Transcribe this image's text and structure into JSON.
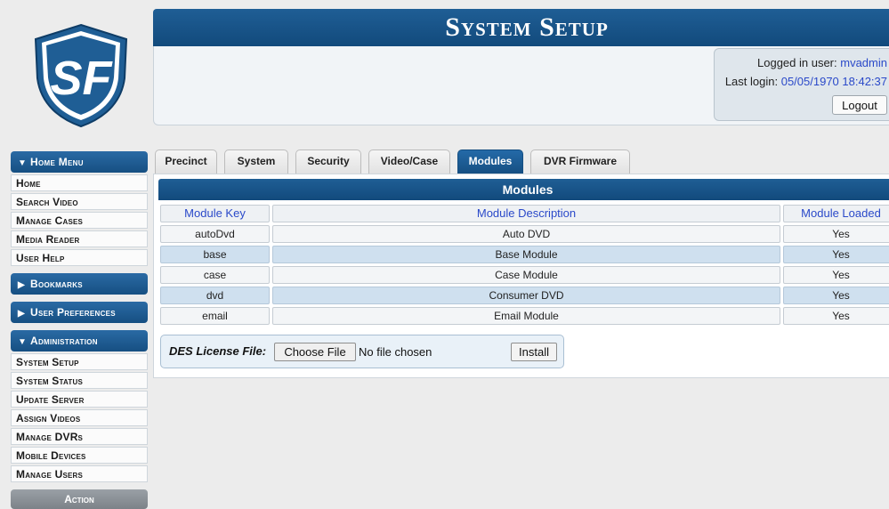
{
  "header": {
    "title": "System Setup"
  },
  "login": {
    "logged_in_label": "Logged in user:",
    "user": "mvadmin",
    "last_login_label": "Last login:",
    "last_login": "05/05/1970 18:42:37",
    "logout": "Logout"
  },
  "logo": {
    "letters": "SF"
  },
  "sidebar": {
    "home_menu": {
      "label": "Home Menu",
      "items": [
        "Home",
        "Search Video",
        "Manage Cases",
        "Media Reader",
        "User Help"
      ]
    },
    "bookmarks": {
      "label": "Bookmarks"
    },
    "user_prefs": {
      "label": "User Preferences"
    },
    "administration": {
      "label": "Administration",
      "items": [
        "System Setup",
        "System Status",
        "Update Server",
        "Assign Videos",
        "Manage DVRs",
        "Mobile Devices",
        "Manage Users"
      ]
    },
    "action": {
      "label": "Action"
    }
  },
  "tabs": [
    "Precinct",
    "System",
    "Security",
    "Video/Case",
    "Modules",
    "DVR Firmware"
  ],
  "active_tab": "Modules",
  "modules": {
    "title": "Modules",
    "columns": [
      "Module Key",
      "Module Description",
      "Module Loaded"
    ],
    "rows": [
      [
        "autoDvd",
        "Auto DVD",
        "Yes"
      ],
      [
        "base",
        "Base Module",
        "Yes"
      ],
      [
        "case",
        "Case Module",
        "Yes"
      ],
      [
        "dvd",
        "Consumer DVD",
        "Yes"
      ],
      [
        "email",
        "Email Module",
        "Yes"
      ]
    ]
  },
  "license": {
    "label": "DES License File:",
    "choose": "Choose File",
    "no_file": "No file chosen",
    "install": "Install"
  },
  "colors": {
    "header_blue": "#1a5a8f",
    "accent_link": "#2a49c9",
    "row_highlight": "#cfe0ef"
  }
}
